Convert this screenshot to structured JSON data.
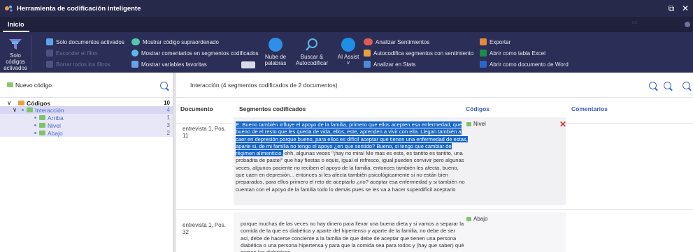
{
  "window": {
    "title": "Herramienta de codificación inteligente",
    "restore_glyph": "⧉",
    "close_glyph": "✕"
  },
  "tabs": {
    "active": "Inicio",
    "dim_glyph": "▭"
  },
  "ribbon": {
    "solo_codigos_label": "Solo códigos activados",
    "solo_documentos": "Solo documentos activados",
    "esconder_filtro": "Esconder el filtro",
    "borrar_filtros": "Borrar todos los filtros",
    "mostrar_supraordenado": "Mostrar código supraordenado",
    "mostrar_comentarios": "Mostrar comentarios en segmentos codificados",
    "mostrar_variables": "Mostrar variables favoritas",
    "nube_palabras": "Nube de palabras",
    "buscar_autocodificar": "Buscar & Autocodificar",
    "ai_assist": "AI Assist",
    "ai_assist_chevron": "˅",
    "analizar_sentimientos": "Analizar Sentimientos",
    "autocodifica_sentimiento": "Autocodifica segmentos con sentimiento",
    "analizar_stats": "Analizar en Stats",
    "exportar": "Exportar",
    "abrir_excel": "Abrir como tabla Excel",
    "abrir_word": "Abrir como documento de Word",
    "colors": {
      "background": "#2b2e57",
      "accent_purple": "#8a7bd9",
      "blue": "#2f8ee6"
    }
  },
  "left_panel": {
    "nuevo_codigo": "Nuevo código",
    "tree": [
      {
        "label": "Códigos",
        "count": "10",
        "expander": "∨"
      },
      {
        "label": "Interacción",
        "count": "4",
        "expander": "∨"
      },
      {
        "label": "Arriba",
        "count": "1"
      },
      {
        "label": "Nivel",
        "count": "3"
      },
      {
        "label": "Abajo",
        "count": "2"
      }
    ]
  },
  "right_panel": {
    "header": "Interacción (4 segmentos codificados de 2 documentos)",
    "columns": {
      "documento": "Documento",
      "segmentos": "Segmentos codificados",
      "codigos": "Códigos",
      "comentarios": "Comentarios"
    },
    "rows": [
      {
        "documento": "entrevista 1, Pos. 11",
        "segment_highlighted": "E: Bueno también influye el apoyo de la familia, primero que ellos acepten esa enfermedad, que bueno de el resto que les queda de vida, ellos, este, aprenden a vivir con ella. Llegan también a caer en depresión porque bueno, para ellos es difícil aceptar que tienen una enfermedad de estas, aparte si, de mi familia no tengo el apoyo ¿en que sentido? Bueno, si tengo que cambiar de régimen alimenticio,",
        "segment_rest": " ehh, algunas veces \"¡hay no mira! Me mas es este, es tantito es tantito, una probadita de pastel\" que hay fiestas o equis, igual el refresco, igual pueden convivir pero algunas veces, algunos paciente no reciben el apoyo de la familia, entonces también les afecta, bueno, que caen en depresión... entonces si les afecta también psicológicamente si no están bien preparados, para ellos primero el reto de aceptarlo ¿no? aceptar esa enfermedad y si también no cuentan con el apoyo de la familia todo lo demás pues se les va a hacer superdifícil aceptarlo",
        "codigo": "Nivel",
        "remove_glyph": "✕"
      },
      {
        "documento": "entrevista 1, Pos. 32",
        "segment_text": "porque muchas de las veces no hay dinero para llevar una buena dieta y si vamos a separar la comida de la que es diabética y aparte del hipertenso y aparte de la familia, no debe de ser así, debe de hacerse conciente a la familia de que debe de aceptar que tienen una persona diabética o una persona hipertensa y para que la comida sea para todos y (hay que saber) qué comen los diabéticos",
        "codigo": "Abajo"
      }
    ]
  }
}
